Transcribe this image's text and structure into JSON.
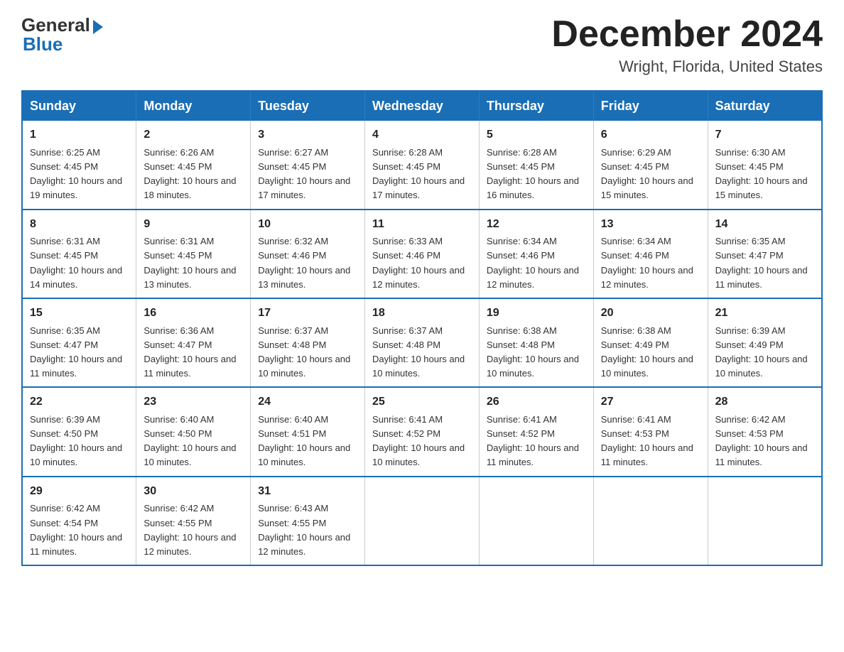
{
  "header": {
    "logo_general": "General",
    "logo_blue": "Blue",
    "month_title": "December 2024",
    "location": "Wright, Florida, United States"
  },
  "weekdays": [
    "Sunday",
    "Monday",
    "Tuesday",
    "Wednesday",
    "Thursday",
    "Friday",
    "Saturday"
  ],
  "weeks": [
    [
      {
        "day": "1",
        "sunrise": "6:25 AM",
        "sunset": "4:45 PM",
        "daylight": "10 hours and 19 minutes."
      },
      {
        "day": "2",
        "sunrise": "6:26 AM",
        "sunset": "4:45 PM",
        "daylight": "10 hours and 18 minutes."
      },
      {
        "day": "3",
        "sunrise": "6:27 AM",
        "sunset": "4:45 PM",
        "daylight": "10 hours and 17 minutes."
      },
      {
        "day": "4",
        "sunrise": "6:28 AM",
        "sunset": "4:45 PM",
        "daylight": "10 hours and 17 minutes."
      },
      {
        "day": "5",
        "sunrise": "6:28 AM",
        "sunset": "4:45 PM",
        "daylight": "10 hours and 16 minutes."
      },
      {
        "day": "6",
        "sunrise": "6:29 AM",
        "sunset": "4:45 PM",
        "daylight": "10 hours and 15 minutes."
      },
      {
        "day": "7",
        "sunrise": "6:30 AM",
        "sunset": "4:45 PM",
        "daylight": "10 hours and 15 minutes."
      }
    ],
    [
      {
        "day": "8",
        "sunrise": "6:31 AM",
        "sunset": "4:45 PM",
        "daylight": "10 hours and 14 minutes."
      },
      {
        "day": "9",
        "sunrise": "6:31 AM",
        "sunset": "4:45 PM",
        "daylight": "10 hours and 13 minutes."
      },
      {
        "day": "10",
        "sunrise": "6:32 AM",
        "sunset": "4:46 PM",
        "daylight": "10 hours and 13 minutes."
      },
      {
        "day": "11",
        "sunrise": "6:33 AM",
        "sunset": "4:46 PM",
        "daylight": "10 hours and 12 minutes."
      },
      {
        "day": "12",
        "sunrise": "6:34 AM",
        "sunset": "4:46 PM",
        "daylight": "10 hours and 12 minutes."
      },
      {
        "day": "13",
        "sunrise": "6:34 AM",
        "sunset": "4:46 PM",
        "daylight": "10 hours and 12 minutes."
      },
      {
        "day": "14",
        "sunrise": "6:35 AM",
        "sunset": "4:47 PM",
        "daylight": "10 hours and 11 minutes."
      }
    ],
    [
      {
        "day": "15",
        "sunrise": "6:35 AM",
        "sunset": "4:47 PM",
        "daylight": "10 hours and 11 minutes."
      },
      {
        "day": "16",
        "sunrise": "6:36 AM",
        "sunset": "4:47 PM",
        "daylight": "10 hours and 11 minutes."
      },
      {
        "day": "17",
        "sunrise": "6:37 AM",
        "sunset": "4:48 PM",
        "daylight": "10 hours and 10 minutes."
      },
      {
        "day": "18",
        "sunrise": "6:37 AM",
        "sunset": "4:48 PM",
        "daylight": "10 hours and 10 minutes."
      },
      {
        "day": "19",
        "sunrise": "6:38 AM",
        "sunset": "4:48 PM",
        "daylight": "10 hours and 10 minutes."
      },
      {
        "day": "20",
        "sunrise": "6:38 AM",
        "sunset": "4:49 PM",
        "daylight": "10 hours and 10 minutes."
      },
      {
        "day": "21",
        "sunrise": "6:39 AM",
        "sunset": "4:49 PM",
        "daylight": "10 hours and 10 minutes."
      }
    ],
    [
      {
        "day": "22",
        "sunrise": "6:39 AM",
        "sunset": "4:50 PM",
        "daylight": "10 hours and 10 minutes."
      },
      {
        "day": "23",
        "sunrise": "6:40 AM",
        "sunset": "4:50 PM",
        "daylight": "10 hours and 10 minutes."
      },
      {
        "day": "24",
        "sunrise": "6:40 AM",
        "sunset": "4:51 PM",
        "daylight": "10 hours and 10 minutes."
      },
      {
        "day": "25",
        "sunrise": "6:41 AM",
        "sunset": "4:52 PM",
        "daylight": "10 hours and 10 minutes."
      },
      {
        "day": "26",
        "sunrise": "6:41 AM",
        "sunset": "4:52 PM",
        "daylight": "10 hours and 11 minutes."
      },
      {
        "day": "27",
        "sunrise": "6:41 AM",
        "sunset": "4:53 PM",
        "daylight": "10 hours and 11 minutes."
      },
      {
        "day": "28",
        "sunrise": "6:42 AM",
        "sunset": "4:53 PM",
        "daylight": "10 hours and 11 minutes."
      }
    ],
    [
      {
        "day": "29",
        "sunrise": "6:42 AM",
        "sunset": "4:54 PM",
        "daylight": "10 hours and 11 minutes."
      },
      {
        "day": "30",
        "sunrise": "6:42 AM",
        "sunset": "4:55 PM",
        "daylight": "10 hours and 12 minutes."
      },
      {
        "day": "31",
        "sunrise": "6:43 AM",
        "sunset": "4:55 PM",
        "daylight": "10 hours and 12 minutes."
      },
      null,
      null,
      null,
      null
    ]
  ]
}
